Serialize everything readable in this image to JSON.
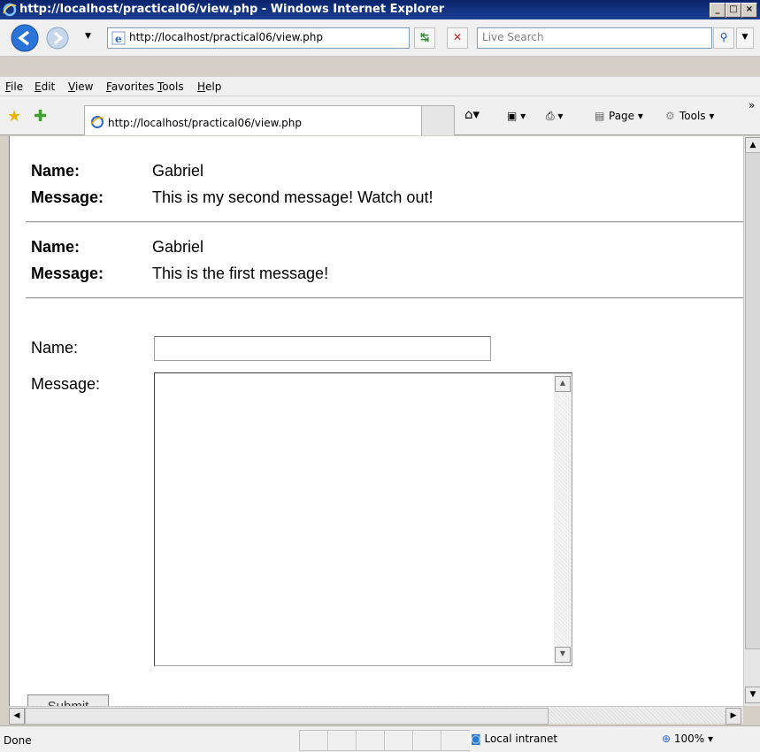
{
  "window": {
    "title": "http://localhost/practical06/view.php - Windows Internet Explorer"
  },
  "address_bar": {
    "url": "http://localhost/practical06/view.php"
  },
  "search": {
    "placeholder": "Live Search"
  },
  "menu": {
    "items": [
      {
        "label": "File"
      },
      {
        "label": "Edit"
      },
      {
        "label": "View"
      },
      {
        "label": "Favorites"
      },
      {
        "label": "Tools"
      },
      {
        "label": "Help"
      }
    ]
  },
  "tab": {
    "title": "http://localhost/practical06/view.php"
  },
  "commands": {
    "page": "Page",
    "tools": "Tools",
    "more": "»"
  },
  "messages": [
    {
      "name_label": "Name:",
      "name": "Gabriel",
      "message_label": "Message:",
      "message": "This is my second message! Watch out!"
    },
    {
      "name_label": "Name:",
      "name": "Gabriel",
      "message_label": "Message:",
      "message": "This is the first message!"
    }
  ],
  "form": {
    "name_label": "Name:",
    "name_value": "",
    "message_label": "Message:",
    "message_value": "",
    "submit_label": "Submit"
  },
  "status": {
    "text": "Done",
    "zone": "Local intranet",
    "zoom": "100%"
  },
  "colors": {
    "titlebar": "#0a246a",
    "chrome": "#f0f0f0",
    "content_bg": "#ffffff"
  }
}
